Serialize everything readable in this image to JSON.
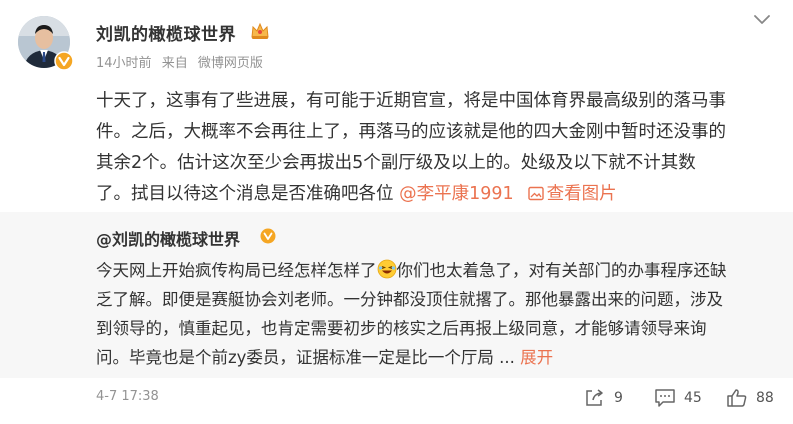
{
  "post": {
    "author": "刘凯的橄榄球世界",
    "time": "14小时前",
    "source_prefix": "来自",
    "source": "微博网页版",
    "text_lines": [
      "十天了，这事有了些进展，有可能于近期官宣，将是中国体育界最高级别的落马事",
      "件。之后，大概率不会再往上了，再落马的应该就是他的四大金刚中暂时还没事的",
      "其余2个。估计这次至少会再拔出5个副厅级及以上的。处级及以下就不计其数",
      "了。拭目以待这个消息是否准确吧各位"
    ],
    "mention": "@李平康1991",
    "view_image": "查看图片"
  },
  "repost": {
    "author": "@刘凯的橄榄球世界",
    "line1_before_emoji": "今天网上开始疯传构局已经怎样怎样了",
    "line1_after_emoji": "你们也太着急了，对有关部门的办事程序还缺",
    "lines": [
      "乏了解。即便是赛艇协会刘老师。一分钟都没顶住就撂了。那他暴露出来的问题，涉及",
      "到领导的，慎重起见，也肯定需要初步的核实之后再报上级同意，才能够请领导来询"
    ],
    "last_line": "问。毕竟也是个前zy委员，证据标准一定是比一个厅局 ",
    "ellipsis": "...",
    "expand": "展开"
  },
  "footer": {
    "date": "4-7 17:38",
    "reposts": "9",
    "comments": "45",
    "likes": "88"
  },
  "icons": {
    "verified": "verified-badge-icon",
    "crown": "crown-icon",
    "chevron": "chevron-down-icon",
    "image": "image-icon",
    "emoji": "laughing-emoji-icon",
    "repost": "repost-icon",
    "comment": "comment-icon",
    "like": "thumbs-up-icon"
  },
  "colors": {
    "link": "#eb7350",
    "verified": "#f5a623",
    "meta": "#939393",
    "repost_bg": "#f7f7f7"
  }
}
